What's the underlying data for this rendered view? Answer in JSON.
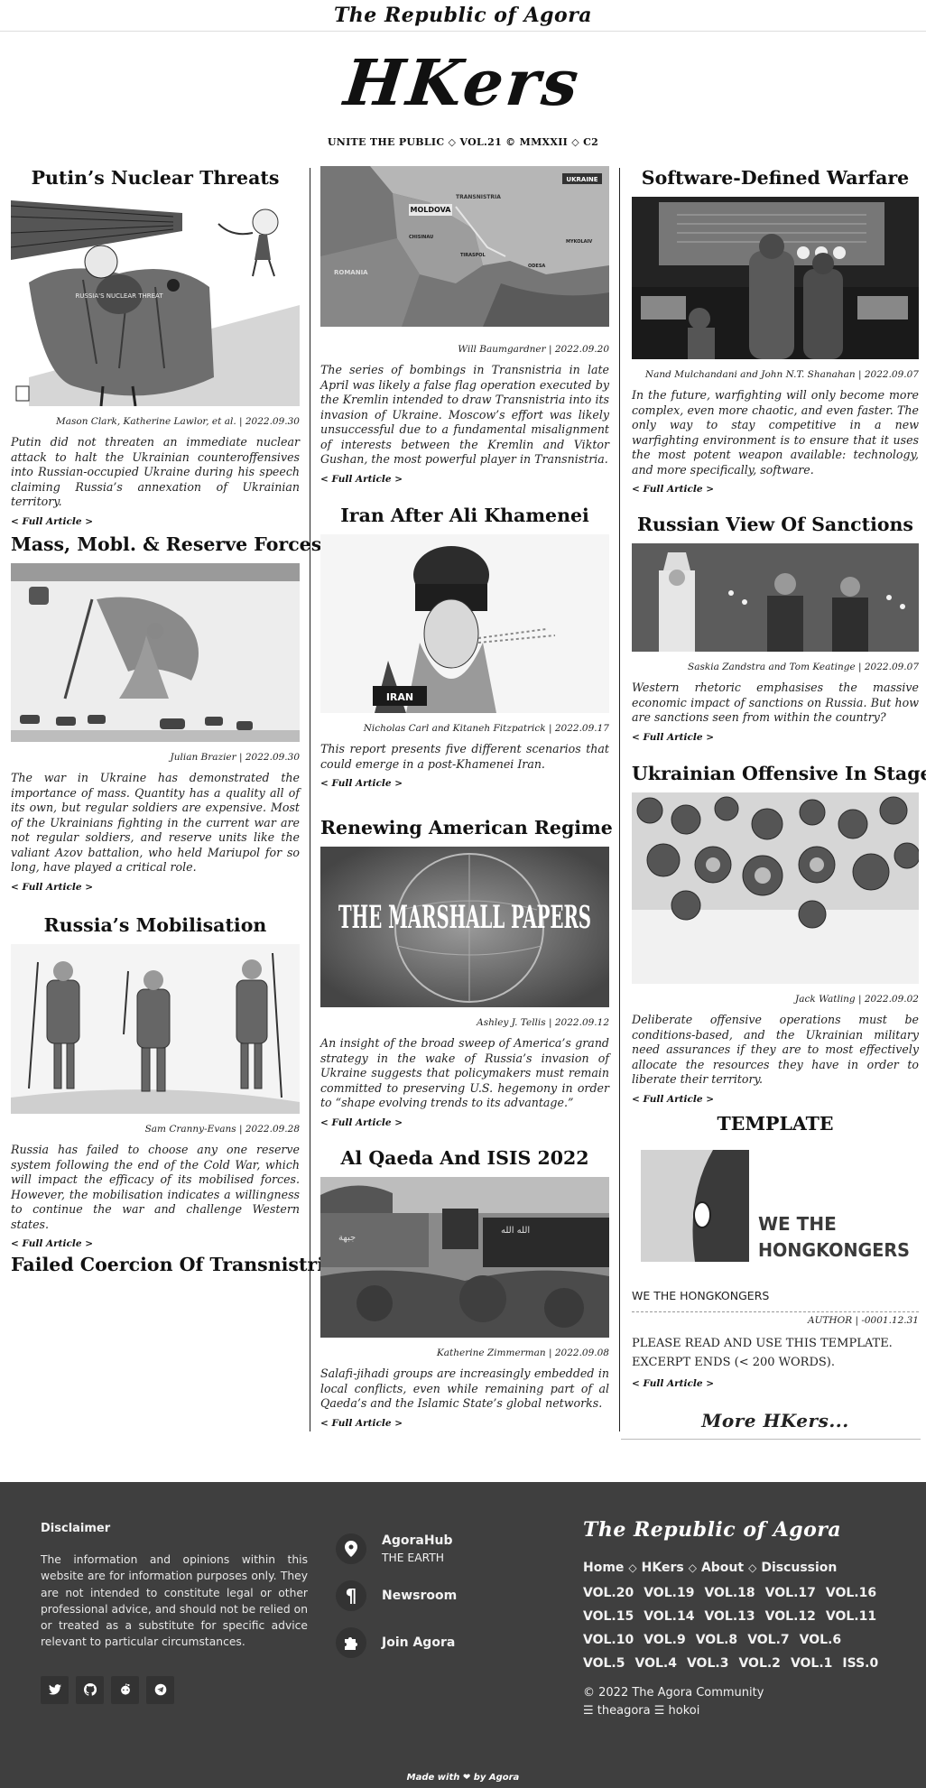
{
  "site": {
    "topbar_title": "The Republic of Agora",
    "masthead": "HKers",
    "tagline": "UNITE THE PUBLIC ◇ VOL.21 © MMXXII ◇ C2"
  },
  "read_more": "< Full Article >",
  "col1": [
    {
      "title": "Putin’s Nuclear Threats",
      "byline": "Mason Clark, Katherine Lawlor, et al. | 2022.09.30",
      "excerpt": "Putin did not threaten an immediate nuclear attack to halt the Ukrainian counteroffensives into Russian-occupied Ukraine during his speech claiming Russia’s annexation of Ukrainian territory.",
      "image_caption": "RUSSIA'S NUCLEAR THREAT"
    },
    {
      "title": "Mass, Mobl. & Reserve Forces",
      "byline": "Julian Brazier | 2022.09.30",
      "excerpt": "The war in Ukraine has demonstrated the importance of mass. Quantity has a quality all of its own, but regular soldiers are expensive. Most of the Ukrainians fighting in the current war are not regular soldiers, and reserve units like the valiant Azov battalion, who held Mariupol for so long, have played a critical role."
    },
    {
      "title": "Russia’s Mobilisation",
      "byline": "Sam Cranny-Evans | 2022.09.28",
      "excerpt": "Russia has failed to choose any one reserve system following the end of the Cold War, which will impact the efficacy of its mobilised forces. However, the mobilisation indicates a willingness to continue the war and challenge Western states."
    },
    {
      "title": "Failed Coercion Of Transnistria"
    }
  ],
  "col2": [
    {
      "title": "",
      "byline": "Will Baumgardner | 2022.09.20",
      "excerpt": "The series of bombings in Transnistria in late April was likely a false flag operation executed by the Kremlin intended to draw Transnistria into its invasion of Ukraine. Moscow’s effort was likely unsuccessful due to a fundamental misalignment of interests between the Kremlin and Viktor Gushan, the most powerful player in Transnistria.",
      "map_labels": [
        "UKRAINE",
        "MOLDOVA",
        "ROMANIA",
        "TRANSNISTRIA",
        "CHISINAU",
        "TIRASPOL",
        "ODESA",
        "MYKOLAIV"
      ]
    },
    {
      "title": "Iran After Ali Khamenei",
      "byline": "Nicholas Carl and Kitaneh Fitzpatrick | 2022.09.17",
      "excerpt": "This report presents five different scenarios that could emerge in a post-Khamenei Iran.",
      "image_caption": "IRAN"
    },
    {
      "title": "Renewing American Regime",
      "byline": "Ashley J. Tellis | 2022.09.12",
      "excerpt": "An insight of the broad sweep of America’s grand strategy in the wake of Russia’s invasion of Ukraine suggests that policymakers must remain committed to preserving U.S. hegemony in order to “shape evolving trends to its advantage.”",
      "image_caption": "THE MARSHALL PAPERS"
    },
    {
      "title": "Al Qaeda And ISIS 2022",
      "byline": "Katherine Zimmerman | 2022.09.08",
      "excerpt": "Salafi-jihadi groups are increasingly embedded in local conflicts, even while remaining part of al Qaeda’s and the Islamic State’s global networks."
    }
  ],
  "col3": [
    {
      "title": "Software-Defined Warfare",
      "byline": "Nand Mulchandani and John N.T. Shanahan | 2022.09.07",
      "excerpt": "In the future, warfighting will only become more complex, even more chaotic, and even faster. The only way to stay competitive in a new warfighting environment is to ensure that it uses the most potent weapon available: technology, and more specifically, software."
    },
    {
      "title": "Russian View Of Sanctions",
      "byline": "Saskia Zandstra and Tom Keatinge | 2022.09.07",
      "excerpt": "Western rhetoric emphasises the massive economic impact of sanctions on Russia. But how are sanctions seen from within the country?"
    },
    {
      "title": "Ukrainian Offensive In Stages",
      "byline": "Jack Watling | 2022.09.02",
      "excerpt": "Deliberate offensive operations must be conditions-based, and the Ukrainian military need assurances if they are to most effectively allocate the resources they have in order to liberate their territory."
    },
    {
      "title": "TEMPLATE",
      "image_text_1": "WE THE",
      "image_text_2": "HONGKONGERS",
      "caption": "WE THE HONGKONGERS",
      "byline": "AUTHOR | -0001.12.31",
      "excerpt_1": "PLEASE READ AND USE THIS TEMPLATE.",
      "excerpt_2": "EXCERPT ENDS (< 200 WORDS)."
    }
  ],
  "more_link": "More HKers...",
  "footer": {
    "disclaimer_title": "Disclaimer",
    "disclaimer_text": "The information and opinions within this website are for information purposes only. They are not intended to constitute legal or other professional advice, and should not be relied on or treated as a substitute for specific advice relevant to particular circumstances.",
    "social_icons": [
      "twitter-icon",
      "github-icon",
      "reddit-icon",
      "telegram-icon"
    ],
    "links": [
      {
        "title": "AgoraHub",
        "sub": "THE EARTH",
        "icon": "map-pin-icon"
      },
      {
        "title": "Newsroom",
        "sub": "",
        "icon": "pilcrow-icon"
      },
      {
        "title": "Join Agora",
        "sub": "",
        "icon": "puzzle-icon"
      }
    ],
    "brand": "The Republic of Agora",
    "nav": [
      "Home",
      "HKers",
      "About",
      "Discussion"
    ],
    "nav_sep": "◇",
    "volumes": [
      "VOL.20",
      "VOL.19",
      "VOL.18",
      "VOL.17",
      "VOL.16",
      "VOL.15",
      "VOL.14",
      "VOL.13",
      "VOL.12",
      "VOL.11",
      "VOL.10",
      "VOL.9",
      "VOL.8",
      "VOL.7",
      "VOL.6",
      "VOL.5",
      "VOL.4",
      "VOL.3",
      "VOL.2",
      "VOL.1",
      "ISS.0"
    ],
    "copyright": "© 2022 The Agora Community",
    "handles": "☰ theagora ☰ hokoi",
    "made_with": "Made with ❤ by Agora"
  }
}
